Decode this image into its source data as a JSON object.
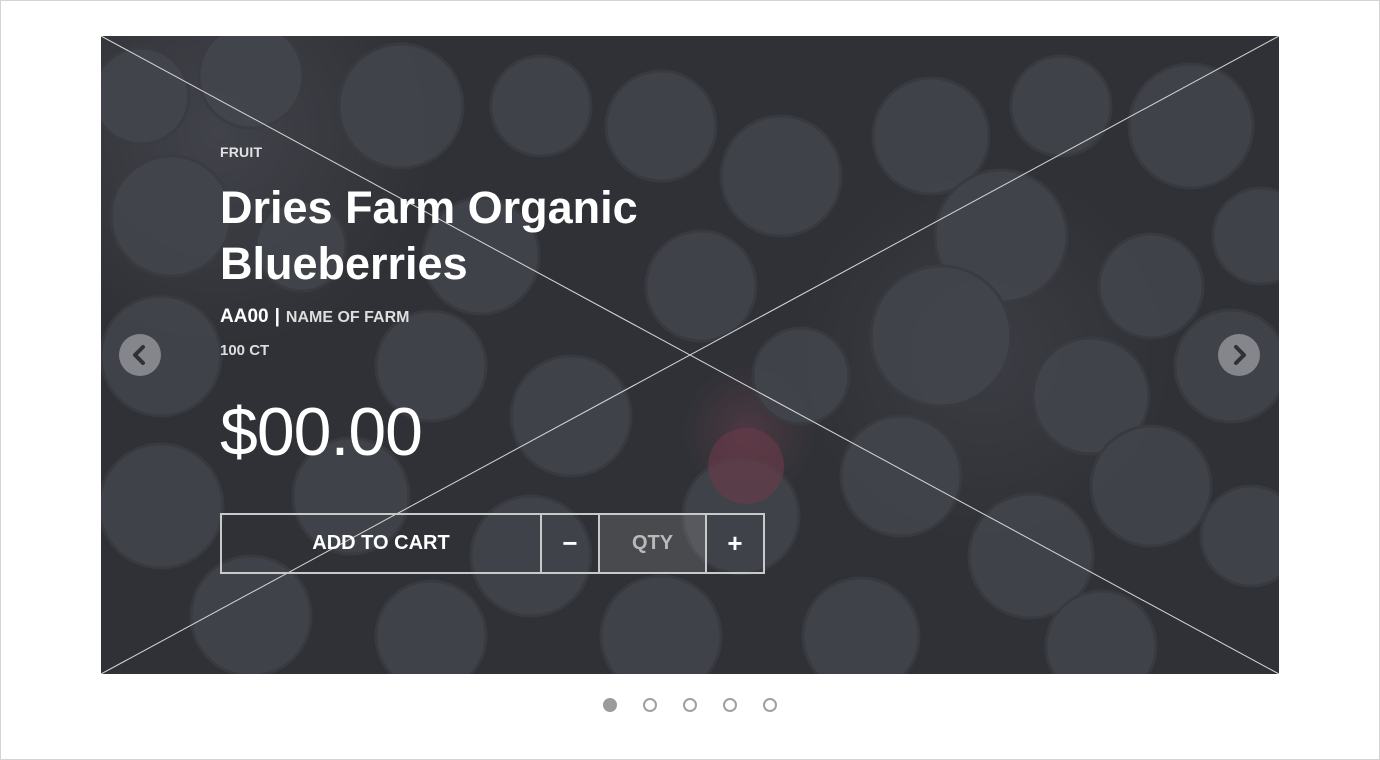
{
  "product": {
    "category": "FRUIT",
    "title": "Dries Farm Organic Blueberries",
    "sku": "AA00",
    "separator": "|",
    "farm": "NAME OF FARM",
    "count": "100 CT",
    "price": "$00.00"
  },
  "cart": {
    "add_label": "ADD TO CART",
    "minus_label": "−",
    "plus_label": "+",
    "qty_placeholder": "QTY"
  },
  "carousel": {
    "prev_icon": "chevron-left-icon",
    "next_icon": "chevron-right-icon",
    "active_index": 0,
    "slide_count": 5
  },
  "colors": {
    "overlay": "#2f3136",
    "text": "#ffffff",
    "border": "#c9c9c9",
    "dot_active": "#9b9b9b"
  }
}
